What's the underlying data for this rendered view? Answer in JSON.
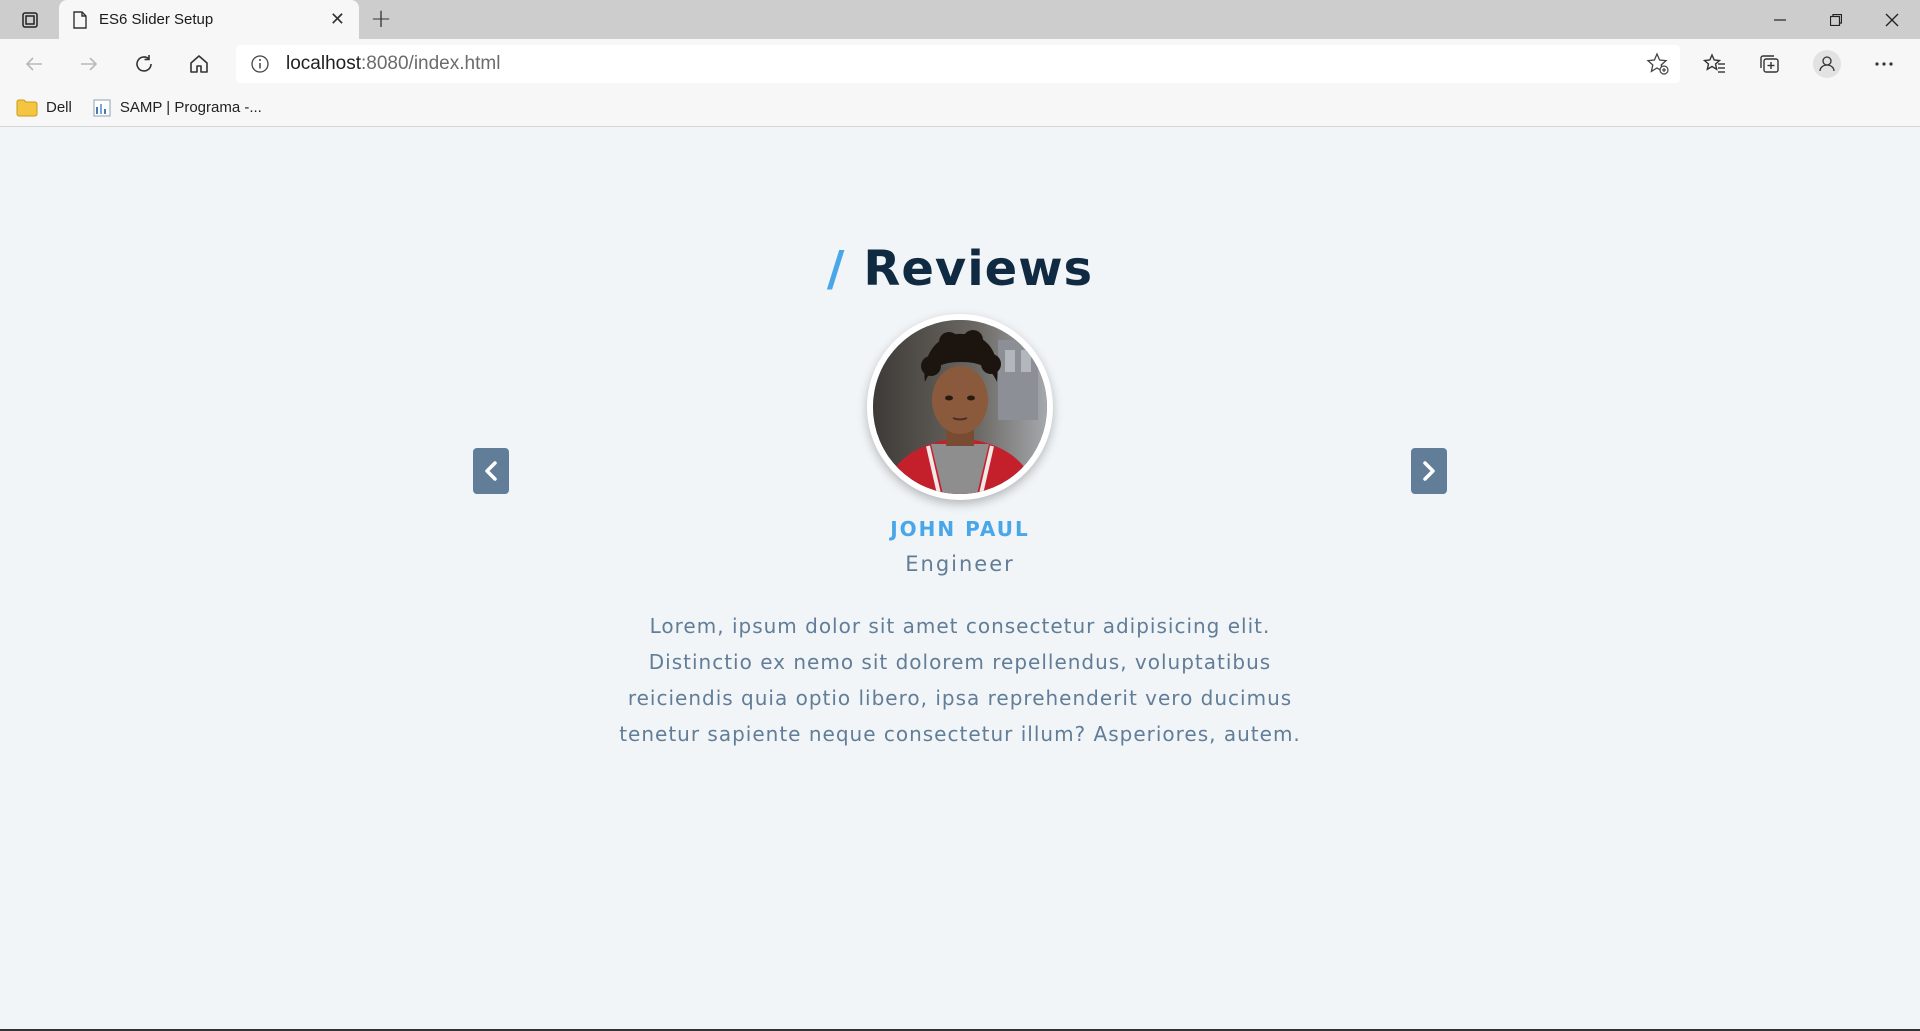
{
  "browser": {
    "tab_title": "ES6 Slider Setup",
    "url_host": "localhost",
    "url_path": ":8080/index.html",
    "bookmarks": [
      {
        "label": "Dell",
        "icon": "folder-icon"
      },
      {
        "label": "SAMP | Programa -...",
        "icon": "document-icon"
      }
    ]
  },
  "page": {
    "heading_slash": "/",
    "heading": "Reviews",
    "review": {
      "name": "John Paul",
      "job": "Engineer",
      "text": "Lorem, ipsum dolor sit amet consectetur adipisicing elit. Distinctio ex nemo sit dolorem repellendus, voluptatibus reiciendis quia optio libero, ipsa reprehenderit vero ducimus tenetur sapiente neque consectetur illum? Asperiores, autem."
    }
  },
  "colors": {
    "accent": "#49a6e9",
    "heading": "#102a42",
    "muted": "#617d98",
    "background": "#f1f5f8"
  }
}
